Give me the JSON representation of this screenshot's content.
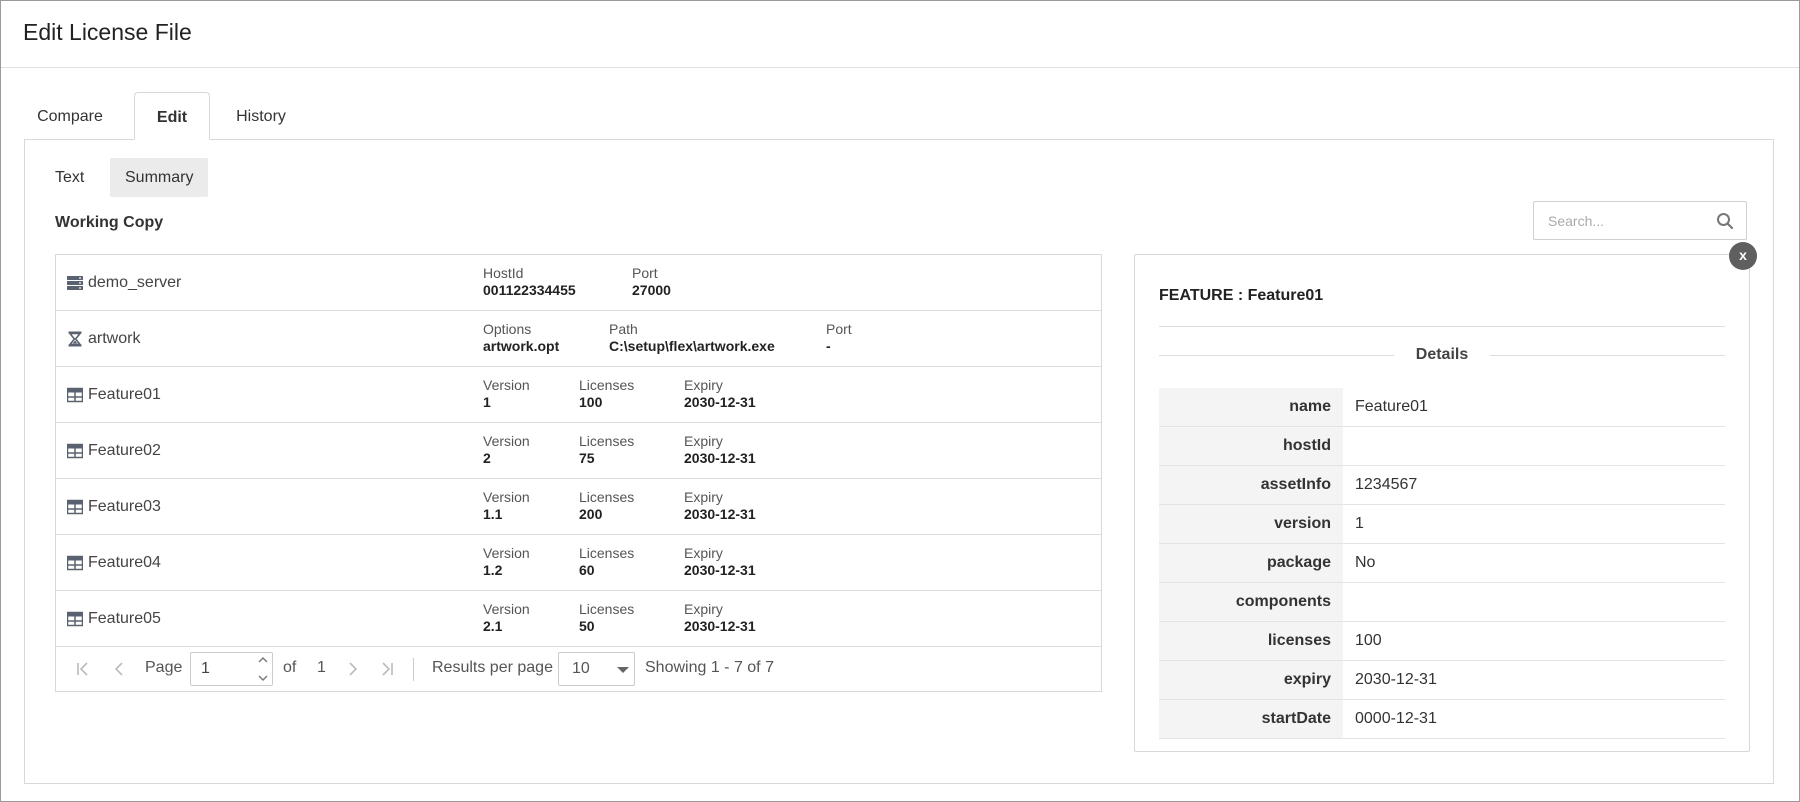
{
  "page": {
    "title": "Edit License File"
  },
  "tabs": [
    {
      "label": "Compare"
    },
    {
      "label": "Edit"
    },
    {
      "label": "History"
    }
  ],
  "subtabs": [
    {
      "label": "Text"
    },
    {
      "label": "Summary"
    }
  ],
  "section": {
    "title": "Working Copy"
  },
  "search": {
    "placeholder": "Search...",
    "value": ""
  },
  "server": {
    "name": "demo_server",
    "icon": "server-icon",
    "hostid_label": "HostId",
    "hostid": "001122334455",
    "port_label": "Port",
    "port": "27000"
  },
  "vendor": {
    "name": "artwork",
    "icon": "hourglass-icon",
    "options_label": "Options",
    "options": "artwork.opt",
    "path_label": "Path",
    "path": "C:\\setup\\flex\\artwork.exe",
    "port_label": "Port",
    "port": "-"
  },
  "feature_labels": {
    "version": "Version",
    "licenses": "Licenses",
    "expiry": "Expiry"
  },
  "features": [
    {
      "name": "Feature01",
      "version": "1",
      "licenses": "100",
      "expiry": "2030-12-31"
    },
    {
      "name": "Feature02",
      "version": "2",
      "licenses": "75",
      "expiry": "2030-12-31"
    },
    {
      "name": "Feature03",
      "version": "1.1",
      "licenses": "200",
      "expiry": "2030-12-31"
    },
    {
      "name": "Feature04",
      "version": "1.2",
      "licenses": "60",
      "expiry": "2030-12-31"
    },
    {
      "name": "Feature05",
      "version": "2.1",
      "licenses": "50",
      "expiry": "2030-12-31"
    }
  ],
  "pager": {
    "page_label": "Page",
    "page": "1",
    "of_label": "of",
    "total_pages": "1",
    "rpp_label": "Results per page",
    "rpp": "10",
    "showing": "Showing 1 - 7 of 7"
  },
  "detail": {
    "close_label": "x",
    "title": "FEATURE : Feature01",
    "details_label": "Details",
    "props": [
      {
        "key": "name",
        "value": "Feature01"
      },
      {
        "key": "hostId",
        "value": ""
      },
      {
        "key": "assetInfo",
        "value": "1234567"
      },
      {
        "key": "version",
        "value": "1"
      },
      {
        "key": "package",
        "value": "No"
      },
      {
        "key": "components",
        "value": ""
      },
      {
        "key": "licenses",
        "value": "100"
      },
      {
        "key": "expiry",
        "value": "2030-12-31"
      },
      {
        "key": "startDate",
        "value": "0000-12-31"
      }
    ]
  }
}
